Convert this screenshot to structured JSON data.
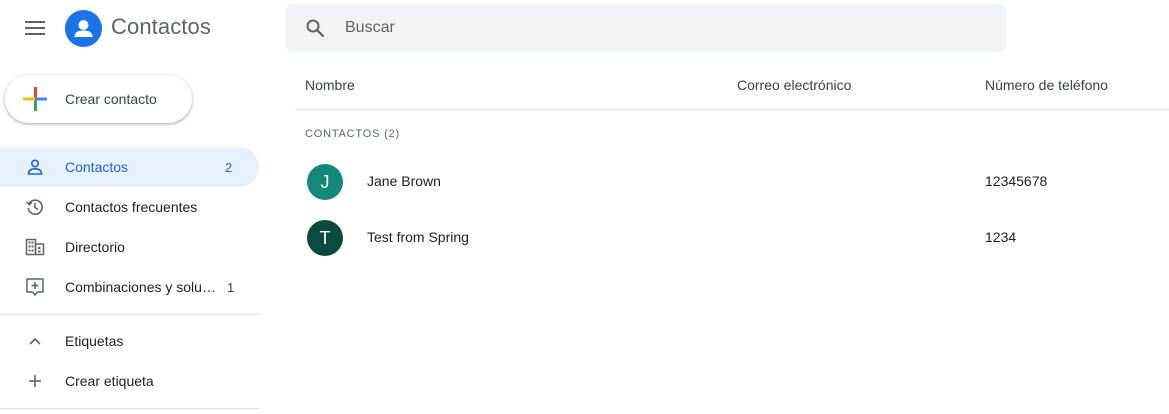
{
  "app": {
    "title": "Contactos",
    "brand_color": "#1a73e8"
  },
  "search": {
    "placeholder": "Buscar"
  },
  "create_button": {
    "label": "Crear contacto"
  },
  "sidebar": {
    "items": [
      {
        "label": "Contactos",
        "count": "2",
        "icon": "person-icon",
        "active": true
      },
      {
        "label": "Contactos frecuentes",
        "count": "",
        "icon": "history-icon",
        "active": false
      },
      {
        "label": "Directorio",
        "count": "",
        "icon": "domain-icon",
        "active": false
      },
      {
        "label": "Combinaciones y solu…",
        "count": "1",
        "icon": "merge-icon",
        "active": false
      }
    ],
    "labels_section": {
      "label": "Etiquetas",
      "icon": "chevron-up-icon"
    },
    "create_label": {
      "label": "Crear etiqueta",
      "icon": "add-icon"
    }
  },
  "table": {
    "columns": [
      "Nombre",
      "Correo electrónico",
      "Número de teléfono"
    ],
    "section_title": "CONTACTOS (2)",
    "rows": [
      {
        "initial": "J",
        "name": "Jane Brown",
        "email": "",
        "phone": "12345678",
        "avatar_color": "#14897a"
      },
      {
        "initial": "T",
        "name": "Test from Spring",
        "email": "",
        "phone": "1234",
        "avatar_color": "#0b4b3d"
      }
    ]
  }
}
